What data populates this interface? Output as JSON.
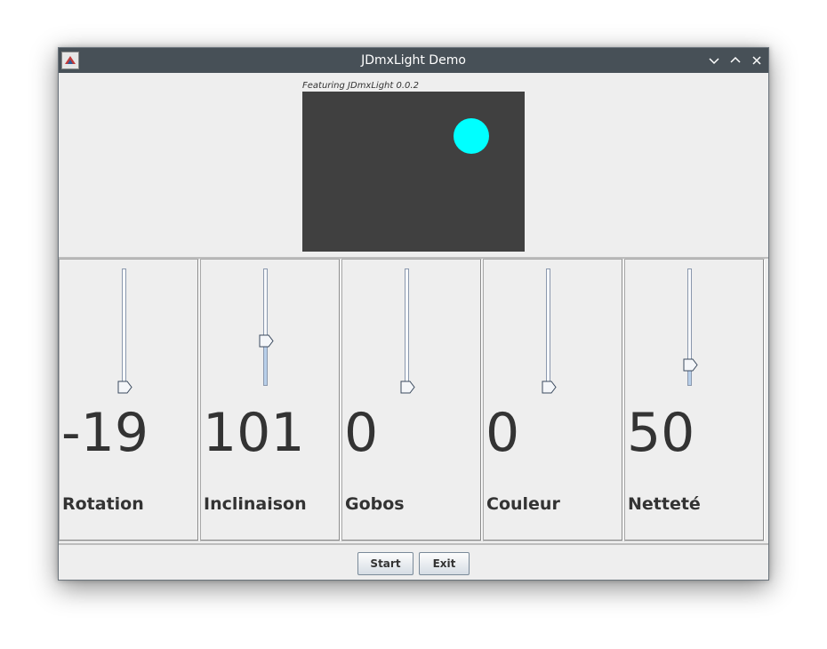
{
  "window": {
    "title": "JDmxLight Demo",
    "controls": {
      "minimize": "chevron-down-icon",
      "maximize": "chevron-up-icon",
      "close": "close-icon"
    }
  },
  "preview": {
    "caption": "Featuring JDmxLight 0.0.2",
    "stage_color": "#404040",
    "beam_color": "#00ffff"
  },
  "sliders": [
    {
      "label": "Rotation",
      "value": "-19",
      "level": 0
    },
    {
      "label": "Inclinaison",
      "value": "101",
      "level": 0.39
    },
    {
      "label": "Gobos",
      "value": "0",
      "level": 0
    },
    {
      "label": "Couleur",
      "value": "0",
      "level": 0
    },
    {
      "label": "Netteté",
      "value": "50",
      "level": 0.19
    }
  ],
  "buttons": {
    "start": "Start",
    "exit": "Exit"
  }
}
